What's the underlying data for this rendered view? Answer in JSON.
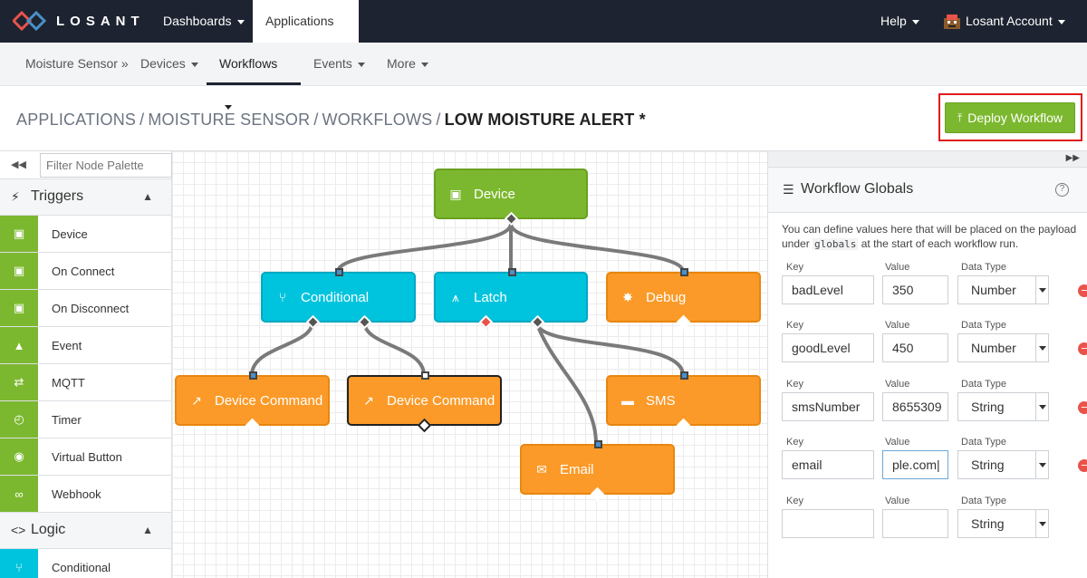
{
  "topnav": {
    "brand": "LOSANT",
    "items": [
      {
        "label": "Dashboards"
      },
      {
        "label": "Applications"
      }
    ],
    "help": "Help",
    "account": "Losant Account"
  },
  "subnav": {
    "items": [
      {
        "label": "Moisture Sensor »"
      },
      {
        "label": "Devices"
      },
      {
        "label": "Workflows"
      },
      {
        "label": "Events"
      },
      {
        "label": "More"
      }
    ]
  },
  "breadcrumb": {
    "parts": [
      "APPLICATIONS",
      "MOISTURE SENSOR",
      "WORKFLOWS"
    ],
    "sep": "/",
    "current": "LOW MOISTURE ALERT *"
  },
  "deploy": {
    "label": "Deploy Workflow",
    "icon": "upload-icon"
  },
  "palette": {
    "filter_placeholder": "Filter Node Palette",
    "triggers_title": "Triggers",
    "triggers": [
      {
        "label": "Device",
        "icon": "chip-icon"
      },
      {
        "label": "On Connect",
        "icon": "chip-icon"
      },
      {
        "label": "On Disconnect",
        "icon": "chip-icon"
      },
      {
        "label": "Event",
        "icon": "warning-icon"
      },
      {
        "label": "MQTT",
        "icon": "arrows-icon"
      },
      {
        "label": "Timer",
        "icon": "timer-icon"
      },
      {
        "label": "Virtual Button",
        "icon": "button-icon"
      },
      {
        "label": "Webhook",
        "icon": "link-icon"
      }
    ],
    "logic_title": "Logic",
    "logic": [
      {
        "label": "Conditional",
        "icon": "fork-icon"
      }
    ]
  },
  "nodes": {
    "device": "Device",
    "conditional": "Conditional",
    "latch": "Latch",
    "debug": "Debug",
    "device_command_1": "Device Command",
    "device_command_2": "Device Command",
    "sms": "SMS",
    "email": "Email"
  },
  "globals": {
    "title": "Workflow Globals",
    "help": "?",
    "desc_1": "You can define values here that will be placed on the payload under",
    "desc_code": "globals",
    "desc_2": "at the start of each workflow run.",
    "key_label": "Key",
    "value_label": "Value",
    "type_label": "Data Type",
    "rows": [
      {
        "key": "badLevel",
        "value": "350",
        "type": "Number"
      },
      {
        "key": "goodLevel",
        "value": "450",
        "type": "Number"
      },
      {
        "key": "smsNumber",
        "value": "8655309",
        "type": "String"
      },
      {
        "key": "email",
        "value": "ple.com|",
        "type": "String"
      },
      {
        "key": "",
        "value": "",
        "type": "String"
      }
    ],
    "remove": "−"
  },
  "colors": {
    "nav": "#1d2330",
    "trigger_green": "#7cb82f",
    "logic_cyan": "#00c4de",
    "output_orange": "#fb9a28",
    "remove_red": "#e8534a"
  }
}
